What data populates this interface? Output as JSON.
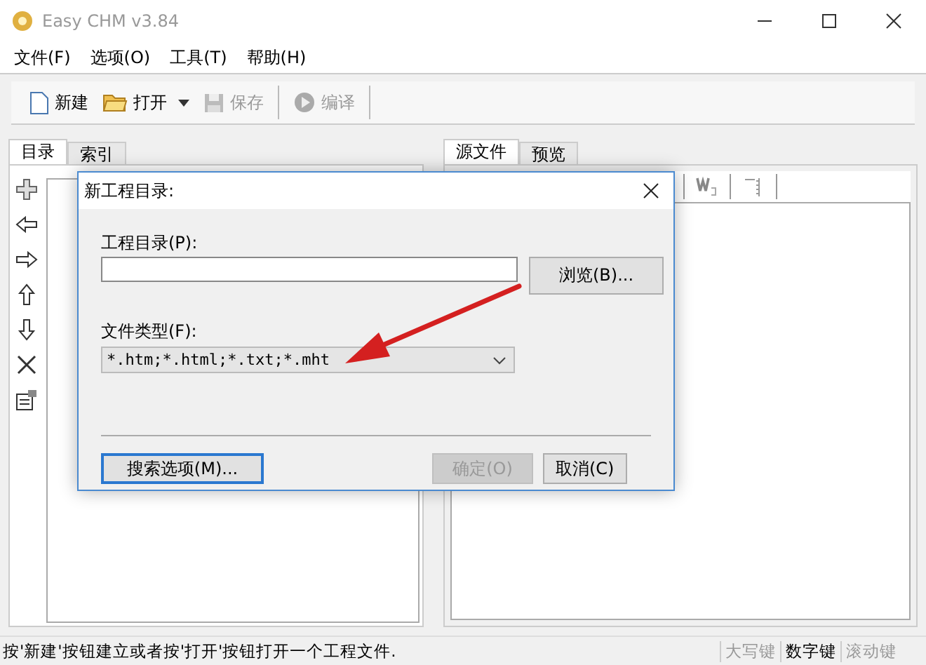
{
  "window": {
    "title": "Easy CHM v3.84"
  },
  "menu": [
    "文件(F)",
    "选项(O)",
    "工具(T)",
    "帮助(H)"
  ],
  "toolbar": [
    {
      "kind": "new",
      "label": "新建",
      "disabled": false
    },
    {
      "kind": "open",
      "label": "打开",
      "disabled": false
    },
    {
      "kind": "save",
      "label": "保存",
      "disabled": true
    },
    {
      "kind": "compile",
      "label": "编译",
      "disabled": true
    }
  ],
  "left_tabs": [
    {
      "label": "目录",
      "selected": true
    },
    {
      "label": "索引",
      "selected": false
    }
  ],
  "right_tabs": [
    {
      "label": "源文件",
      "selected": true
    },
    {
      "label": "预览",
      "selected": false
    }
  ],
  "dialog": {
    "title": "新工程目录:",
    "dir_label": "工程目录(P):",
    "browse": "浏览(B)...",
    "type_label": "文件类型(F):",
    "type_value": "*.htm;*.html;*.txt;*.mht",
    "buttons": [
      {
        "label": "搜索选项(M)...",
        "disabled": false,
        "focused": true
      },
      {
        "label": "确定(O)",
        "disabled": true,
        "focused": false
      },
      {
        "label": "取消(C)",
        "disabled": false,
        "focused": false
      }
    ]
  },
  "status_bar": {
    "message": "按'新建'按钮建立或者按'打开'按钮打开一个工程文件.",
    "keys": [
      {
        "label": "大写键",
        "on": false
      },
      {
        "label": "数字键",
        "on": true
      },
      {
        "label": "滚动键",
        "on": false
      }
    ]
  }
}
